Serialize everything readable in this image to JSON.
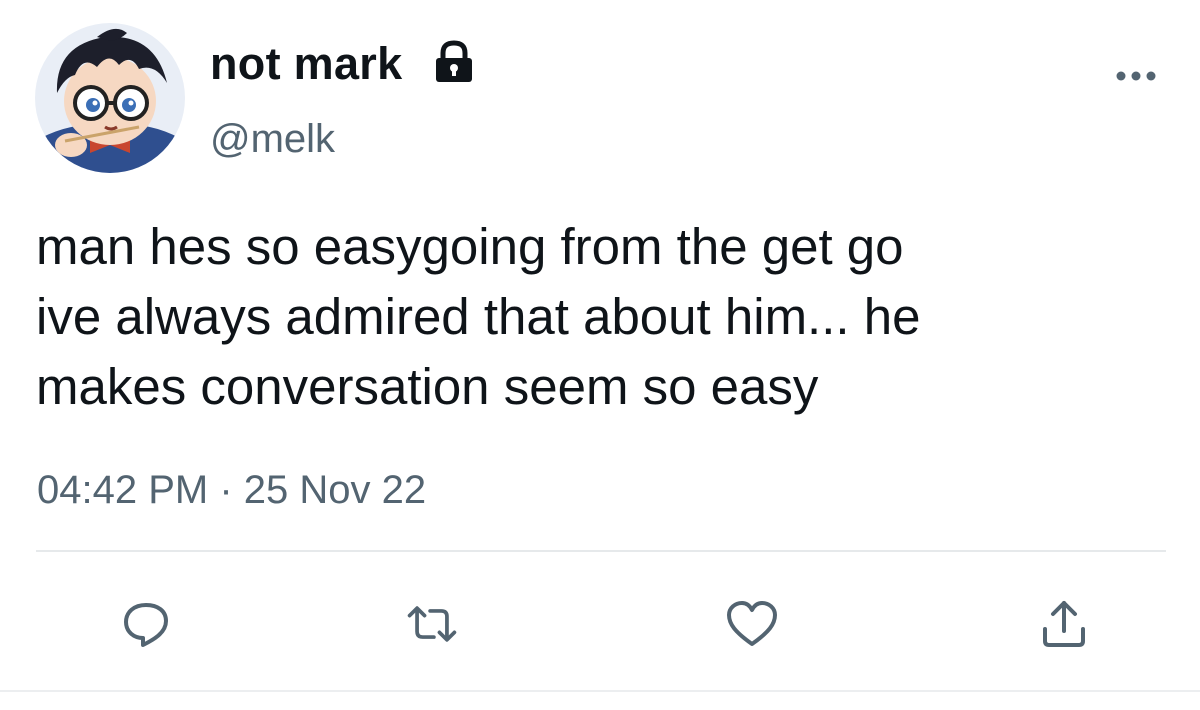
{
  "author": {
    "display_name": "not mark",
    "handle": "@melk",
    "avatar_icon": "anime-character-avatar",
    "protected_icon": "lock-icon"
  },
  "tweet": {
    "lines": [
      "man hes so easygoing from the get go",
      "ive always admired that about him... he",
      "makes conversation seem so easy"
    ],
    "timestamp": "04:42 PM · 25 Nov 22"
  },
  "actions": {
    "reply_icon": "reply-icon",
    "retweet_icon": "retweet-icon",
    "like_icon": "heart-icon",
    "share_icon": "share-icon",
    "more_icon": "more-icon"
  },
  "colors": {
    "text_primary": "#0f1419",
    "text_secondary": "#536471",
    "icon": "#536471",
    "divider": "#e6e9eb"
  }
}
